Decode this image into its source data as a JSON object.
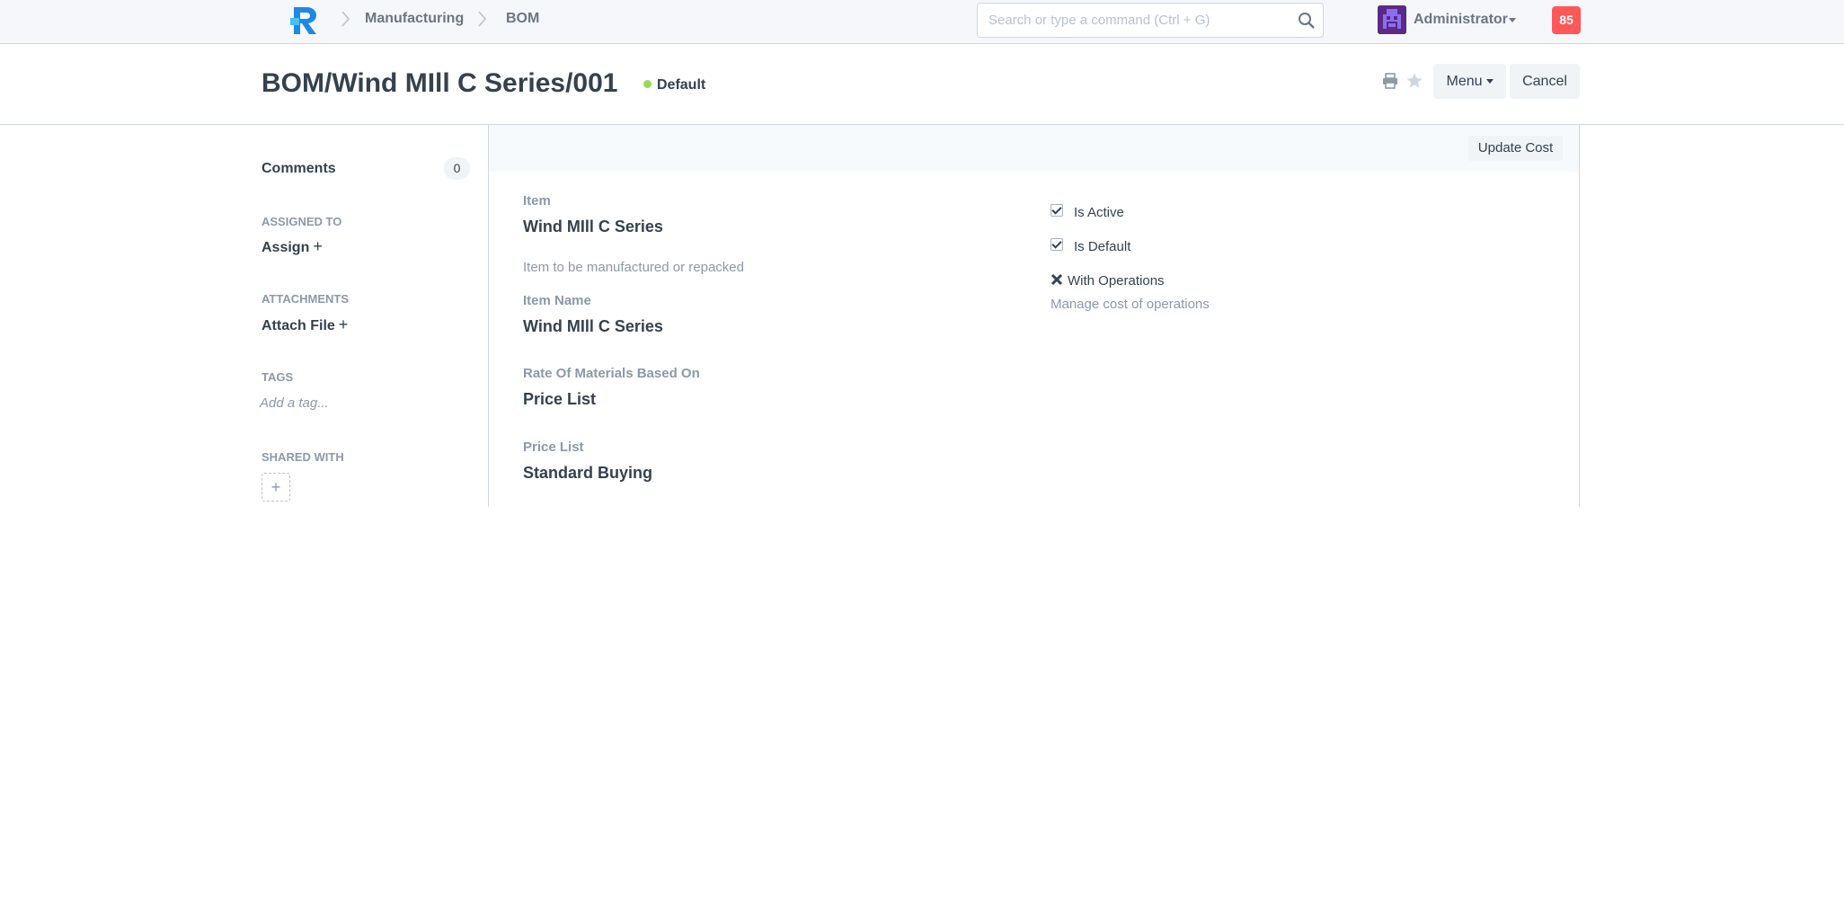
{
  "navbar": {
    "breadcrumbs": [
      "Manufacturing",
      "BOM"
    ],
    "search_placeholder": "Search or type a command (Ctrl + G)",
    "user_name": "Administrator",
    "notification_count": "85"
  },
  "page_head": {
    "title": "BOM/Wind MIll C Series/001",
    "status": "Default",
    "status_color": "#98d85b",
    "menu_label": "Menu",
    "cancel_label": "Cancel"
  },
  "sidebar": {
    "comments_label": "Comments",
    "comments_count": "0",
    "assigned_heading": "ASSIGNED TO",
    "assign_label": "Assign",
    "attachments_heading": "ATTACHMENTS",
    "attach_label": "Attach File",
    "tags_heading": "TAGS",
    "tag_placeholder": "Add a tag...",
    "shared_heading": "SHARED WITH"
  },
  "form": {
    "update_cost_label": "Update Cost",
    "item_label": "Item",
    "item_value": "Wind MIll C Series",
    "item_description": "Item to be manufactured or repacked",
    "item_name_label": "Item Name",
    "item_name_value": "Wind MIll C Series",
    "rate_label": "Rate Of Materials Based On",
    "rate_value": "Price List",
    "price_list_label": "Price List",
    "price_list_value": "Standard Buying",
    "is_active_label": "Is Active",
    "is_active": true,
    "is_default_label": "Is Default",
    "is_default": true,
    "with_operations_label": "With Operations",
    "with_operations": false,
    "with_operations_description": "Manage cost of operations"
  }
}
